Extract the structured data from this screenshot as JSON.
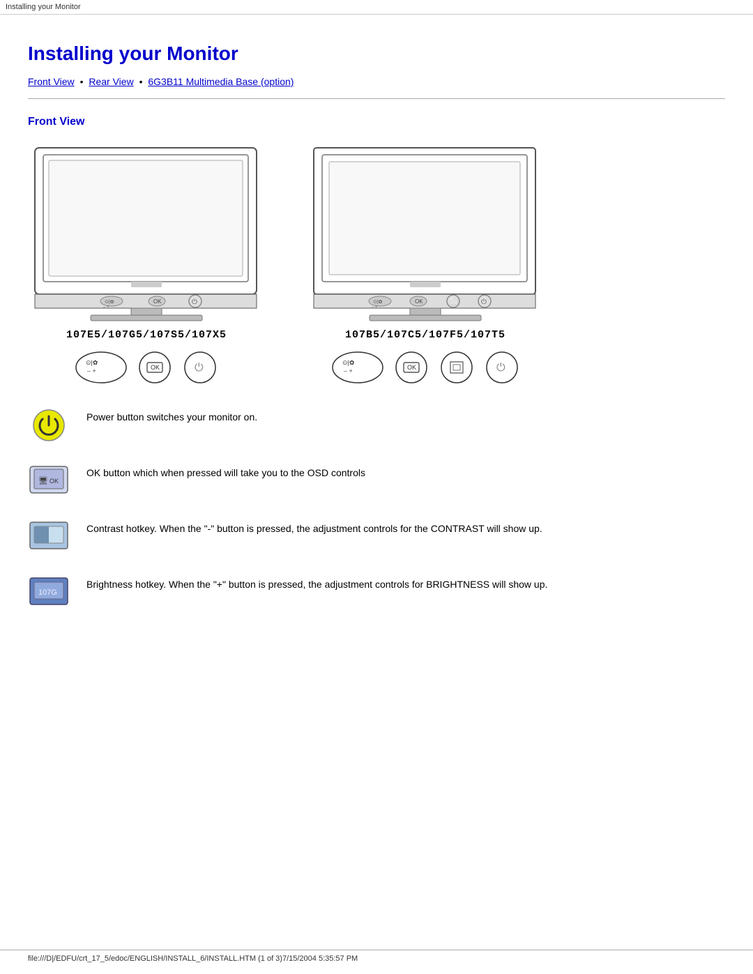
{
  "browser_tab": "Installing your Monitor",
  "page_title": "Installing your Monitor",
  "nav": {
    "link1": "Front View",
    "sep1": "•",
    "link2": "Rear View",
    "sep2": "•",
    "link3": "6G3B11 Multimedia Base (option)"
  },
  "section_front": {
    "title": "Front View",
    "monitor1_label": "107E5/107G5/107S5/107X5",
    "monitor2_label": "107B5/107C5/107F5/107T5"
  },
  "features": [
    {
      "id": "power",
      "text": "Power button switches your monitor on."
    },
    {
      "id": "ok",
      "text": "OK button which when pressed will take you to the OSD controls"
    },
    {
      "id": "contrast",
      "text": "Contrast hotkey. When the \"-\" button is pressed, the adjustment controls for the CONTRAST will show up."
    },
    {
      "id": "brightness",
      "text": "Brightness hotkey. When the \"+\" button is pressed, the adjustment controls for BRIGHTNESS will show up."
    }
  ],
  "footer": "file:///D|/EDFU/crt_17_5/edoc/ENGLISH/INSTALL_6/INSTALL.HTM (1 of 3)7/15/2004 5:35:57 PM"
}
